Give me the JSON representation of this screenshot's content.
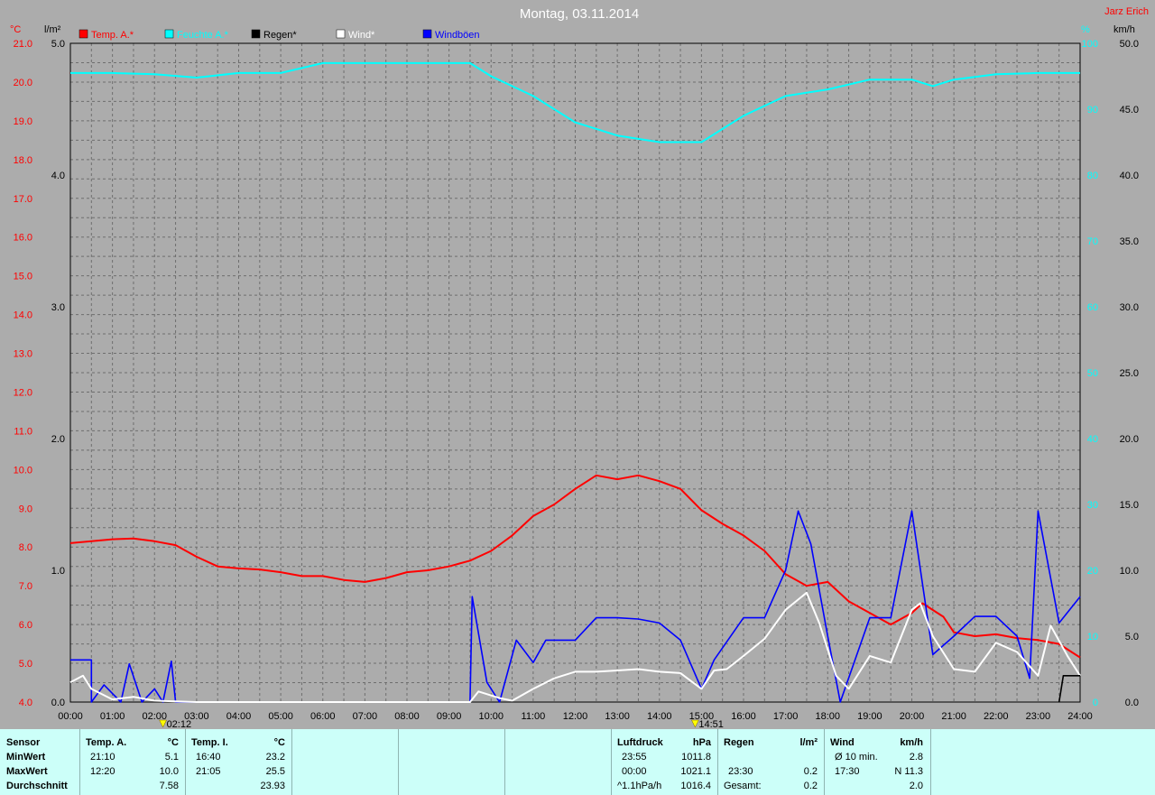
{
  "title": "Montag, 03.11.2014",
  "author": "Jarz Erich",
  "colors": {
    "temp": "#ff0000",
    "humidity": "#00ffff",
    "rain": "#000000",
    "wind": "#ffffff",
    "gusts": "#0000ff",
    "background": "#acacac",
    "stats_bg": "#ccfff9"
  },
  "chart_data": {
    "type": "line",
    "x_unit": "time of day (hours)",
    "x_range": [
      0,
      24
    ],
    "x_ticks": [
      "00:00",
      "01:00",
      "02:00",
      "03:00",
      "04:00",
      "05:00",
      "06:00",
      "07:00",
      "08:00",
      "09:00",
      "10:00",
      "11:00",
      "12:00",
      "13:00",
      "14:00",
      "15:00",
      "16:00",
      "17:00",
      "18:00",
      "19:00",
      "20:00",
      "21:00",
      "22:00",
      "23:00",
      "24:00"
    ],
    "axes": {
      "temp": {
        "label": "°C",
        "range": [
          4,
          21
        ],
        "ticks": [
          "21.0",
          "20.0",
          "19.0",
          "18.0",
          "17.0",
          "16.0",
          "15.0",
          "14.0",
          "13.0",
          "12.0",
          "11.0",
          "10.0",
          "9.0",
          "8.0",
          "7.0",
          "6.0",
          "5.0",
          "4.0"
        ]
      },
      "rain": {
        "label": "l/m²",
        "range": [
          0,
          5
        ],
        "ticks": [
          "5.0",
          "4.0",
          "3.0",
          "2.0",
          "1.0",
          "0.0"
        ]
      },
      "humidity": {
        "label": "%",
        "range": [
          0,
          100
        ],
        "ticks": [
          "100",
          "90",
          "80",
          "70",
          "60",
          "50",
          "40",
          "30",
          "20",
          "10",
          "0"
        ]
      },
      "wind": {
        "label": "km/h",
        "range": [
          0,
          50
        ],
        "ticks": [
          "50.0",
          "45.0",
          "40.0",
          "35.0",
          "30.0",
          "25.0",
          "20.0",
          "15.0",
          "10.0",
          "5.0",
          "0.0"
        ]
      }
    },
    "markers": [
      {
        "x": 2.2,
        "label": "02:12",
        "icon": "moon"
      },
      {
        "x": 14.85,
        "label": "14:51",
        "icon": "sun"
      }
    ],
    "series": [
      {
        "name": "Temp. A.*",
        "axis": "temp",
        "color": "#ff0000",
        "points": [
          [
            0,
            8.1
          ],
          [
            0.5,
            8.15
          ],
          [
            1,
            8.2
          ],
          [
            1.5,
            8.22
          ],
          [
            2,
            8.15
          ],
          [
            2.5,
            8.05
          ],
          [
            3,
            7.75
          ],
          [
            3.5,
            7.5
          ],
          [
            4,
            7.45
          ],
          [
            4.5,
            7.42
          ],
          [
            5,
            7.35
          ],
          [
            5.5,
            7.25
          ],
          [
            6,
            7.25
          ],
          [
            6.5,
            7.15
          ],
          [
            7,
            7.1
          ],
          [
            7.5,
            7.2
          ],
          [
            8,
            7.35
          ],
          [
            8.5,
            7.4
          ],
          [
            9,
            7.5
          ],
          [
            9.5,
            7.65
          ],
          [
            10,
            7.9
          ],
          [
            10.5,
            8.3
          ],
          [
            11,
            8.8
          ],
          [
            11.5,
            9.1
          ],
          [
            12,
            9.5
          ],
          [
            12.5,
            9.85
          ],
          [
            13,
            9.75
          ],
          [
            13.5,
            9.85
          ],
          [
            14,
            9.7
          ],
          [
            14.5,
            9.5
          ],
          [
            15,
            8.95
          ],
          [
            15.5,
            8.6
          ],
          [
            16,
            8.3
          ],
          [
            16.5,
            7.9
          ],
          [
            17,
            7.3
          ],
          [
            17.5,
            7.0
          ],
          [
            18,
            7.1
          ],
          [
            18.5,
            6.6
          ],
          [
            19,
            6.3
          ],
          [
            19.5,
            6.0
          ],
          [
            20,
            6.3
          ],
          [
            20.25,
            6.55
          ],
          [
            20.75,
            6.2
          ],
          [
            21,
            5.8
          ],
          [
            21.5,
            5.7
          ],
          [
            22,
            5.75
          ],
          [
            22.5,
            5.65
          ],
          [
            23,
            5.6
          ],
          [
            23.5,
            5.5
          ],
          [
            24,
            5.15
          ]
        ]
      },
      {
        "name": "Feuchte A.*",
        "axis": "humidity",
        "color": "#00ffff",
        "points": [
          [
            0,
            95.5
          ],
          [
            1,
            95.5
          ],
          [
            2,
            95.3
          ],
          [
            3,
            94.8
          ],
          [
            4,
            95.5
          ],
          [
            5,
            95.5
          ],
          [
            6,
            97
          ],
          [
            7,
            97
          ],
          [
            8,
            97
          ],
          [
            9,
            97
          ],
          [
            9.5,
            97
          ],
          [
            10,
            95
          ],
          [
            11,
            92
          ],
          [
            12,
            88
          ],
          [
            13,
            86
          ],
          [
            14,
            85
          ],
          [
            15,
            85
          ],
          [
            15.5,
            87
          ],
          [
            16,
            89
          ],
          [
            17,
            92
          ],
          [
            18,
            93
          ],
          [
            19,
            94.5
          ],
          [
            20,
            94.5
          ],
          [
            20.5,
            93.5
          ],
          [
            21,
            94.5
          ],
          [
            22,
            95.3
          ],
          [
            23,
            95.5
          ],
          [
            24,
            95.5
          ]
        ]
      },
      {
        "name": "Regen*",
        "axis": "rain",
        "color": "#000000",
        "points": [
          [
            23.5,
            0
          ],
          [
            23.6,
            0.2
          ],
          [
            23.8,
            0.2
          ],
          [
            24,
            0.2
          ]
        ]
      },
      {
        "name": "Wind*",
        "axis": "wind",
        "color": "#ffffff",
        "points": [
          [
            0,
            1.5
          ],
          [
            0.3,
            2.0
          ],
          [
            0.5,
            1.0
          ],
          [
            1,
            0.2
          ],
          [
            1.5,
            0.4
          ],
          [
            2,
            0.1
          ],
          [
            3,
            0
          ],
          [
            9.5,
            0
          ],
          [
            9.7,
            0.8
          ],
          [
            10.2,
            0.3
          ],
          [
            10.5,
            0.1
          ],
          [
            11,
            1.0
          ],
          [
            11.5,
            1.8
          ],
          [
            12,
            2.3
          ],
          [
            12.5,
            2.3
          ],
          [
            13,
            2.4
          ],
          [
            13.5,
            2.5
          ],
          [
            14,
            2.3
          ],
          [
            14.5,
            2.2
          ],
          [
            15,
            1.0
          ],
          [
            15.3,
            2.4
          ],
          [
            15.6,
            2.5
          ],
          [
            16,
            3.5
          ],
          [
            16.5,
            4.8
          ],
          [
            17,
            7.0
          ],
          [
            17.5,
            8.3
          ],
          [
            17.8,
            6.0
          ],
          [
            18.2,
            2.0
          ],
          [
            18.5,
            1.0
          ],
          [
            19,
            3.5
          ],
          [
            19.5,
            3.0
          ],
          [
            20,
            7.0
          ],
          [
            20.2,
            7.5
          ],
          [
            20.5,
            5.0
          ],
          [
            21,
            2.5
          ],
          [
            21.5,
            2.3
          ],
          [
            22,
            4.5
          ],
          [
            22.5,
            3.8
          ],
          [
            23,
            2.0
          ],
          [
            23.3,
            5.8
          ],
          [
            23.7,
            3.5
          ],
          [
            24,
            2.0
          ]
        ]
      },
      {
        "name": "Windböen",
        "axis": "wind",
        "color": "#0000ff",
        "points": [
          [
            0,
            3.2
          ],
          [
            0.5,
            3.2
          ],
          [
            0.5,
            0
          ],
          [
            0.8,
            1.3
          ],
          [
            1.2,
            0
          ],
          [
            1.4,
            2.9
          ],
          [
            1.7,
            0
          ],
          [
            2,
            1.0
          ],
          [
            2.2,
            0.0
          ],
          [
            2.4,
            3.1
          ],
          [
            2.5,
            0
          ],
          [
            9.5,
            0
          ],
          [
            9.55,
            8.0
          ],
          [
            9.9,
            1.5
          ],
          [
            10.2,
            0
          ],
          [
            10.6,
            4.7
          ],
          [
            11,
            3.0
          ],
          [
            11.3,
            4.7
          ],
          [
            12,
            4.7
          ],
          [
            12.5,
            6.4
          ],
          [
            13,
            6.4
          ],
          [
            13.5,
            6.3
          ],
          [
            14,
            6.0
          ],
          [
            14.5,
            4.7
          ],
          [
            15,
            1.0
          ],
          [
            15.3,
            3.2
          ],
          [
            16,
            6.4
          ],
          [
            16.5,
            6.4
          ],
          [
            17,
            10.0
          ],
          [
            17.3,
            14.5
          ],
          [
            17.6,
            12.0
          ],
          [
            18,
            5.0
          ],
          [
            18.3,
            0
          ],
          [
            19,
            6.4
          ],
          [
            19.5,
            6.4
          ],
          [
            20,
            14.5
          ],
          [
            20.5,
            3.6
          ],
          [
            21,
            5.0
          ],
          [
            21.5,
            6.5
          ],
          [
            22,
            6.5
          ],
          [
            22.5,
            5.0
          ],
          [
            22.8,
            1.8
          ],
          [
            23,
            14.5
          ],
          [
            23.5,
            6.0
          ],
          [
            24,
            8.0
          ]
        ]
      }
    ]
  },
  "stats": {
    "sensor": {
      "header": "Sensor",
      "min": "MinWert",
      "max": "MaxWert",
      "avg": "Durchschnitt"
    },
    "temp_a": {
      "header": "Temp. A.",
      "unit": "°C",
      "min_time": "21:10",
      "min_val": "5.1",
      "max_time": "12:20",
      "max_val": "10.0",
      "avg": "7.58"
    },
    "temp_i": {
      "header": "Temp. I.",
      "unit": "°C",
      "min_time": "16:40",
      "min_val": "23.2",
      "max_time": "21:05",
      "max_val": "25.5",
      "avg": "23.93"
    },
    "pressure": {
      "header": "Luftdruck",
      "unit": "hPa",
      "min_time": "23:55",
      "min_val": "1011.8",
      "max_time": "00:00",
      "max_val": "1021.1",
      "trend": "^1.1hPa/h",
      "avg": "1016.4"
    },
    "rain": {
      "header": "Regen",
      "unit": "l/m²",
      "max_time": "23:30",
      "max_val": "0.2",
      "total_label": "Gesamt:",
      "total": "0.2"
    },
    "wind": {
      "header": "Wind",
      "unit": "km/h",
      "min_label": "Ø 10 min.",
      "min_val": "2.8",
      "max_time": "17:30",
      "max_val": "N 11.3",
      "avg": "2.0"
    }
  }
}
